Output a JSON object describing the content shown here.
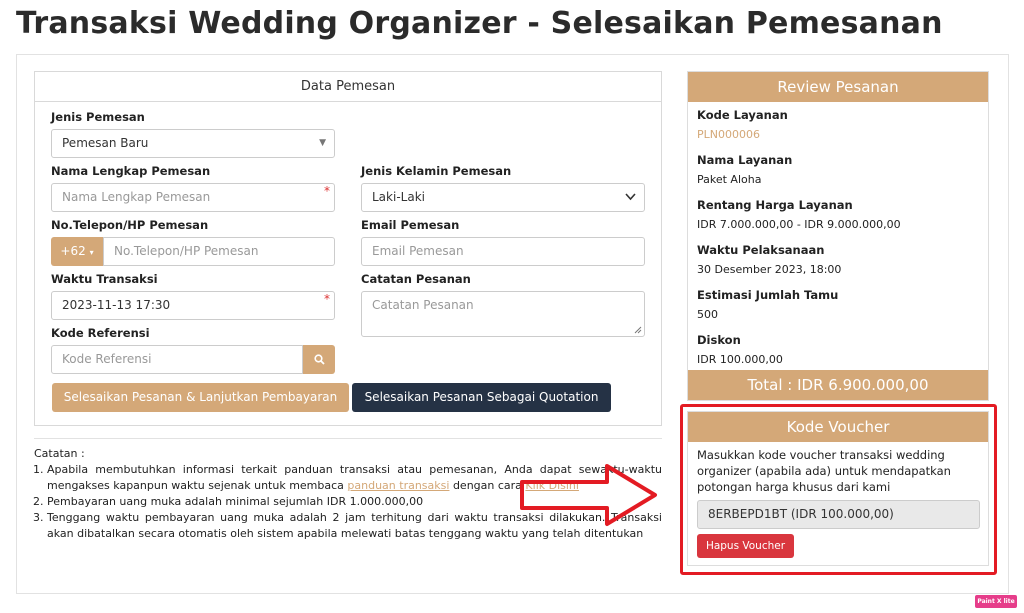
{
  "page": {
    "title": "Transaksi Wedding Organizer - Selesaikan Pemesanan"
  },
  "form": {
    "header": "Data Pemesan",
    "jenis_pemesan": {
      "label": "Jenis Pemesan",
      "value": "Pemesan Baru"
    },
    "nama": {
      "label": "Nama Lengkap Pemesan",
      "placeholder": "Nama Lengkap Pemesan"
    },
    "jenis_kelamin": {
      "label": "Jenis Kelamin Pemesan",
      "value": "Laki-Laki"
    },
    "telepon": {
      "label": "No.Telepon/HP Pemesan",
      "prefix": "+62",
      "placeholder": "No.Telepon/HP Pemesan"
    },
    "email": {
      "label": "Email Pemesan",
      "placeholder": "Email Pemesan"
    },
    "waktu": {
      "label": "Waktu Transaksi",
      "value": "2023-11-13 17:30"
    },
    "catatan": {
      "label": "Catatan Pesanan",
      "placeholder": "Catatan Pesanan"
    },
    "referensi": {
      "label": "Kode Referensi",
      "placeholder": "Kode Referensi"
    },
    "btn_bayar": "Selesaikan Pesanan & Lanjutkan Pembayaran",
    "btn_quotation": "Selesaikan Pesanan Sebagai Quotation"
  },
  "notes": {
    "title": "Catatan :",
    "item1_a": "Apabila membutuhkan informasi terkait panduan transaksi atau pemesanan, Anda dapat sewaktu-waktu mengakses kapanpun waktu sejenak untuk membaca ",
    "item1_link1": "panduan transaksi",
    "item1_b": " dengan cara ",
    "item1_link2": "Klik Disini",
    "item2": "Pembayaran uang muka adalah minimal sejumlah IDR 1.000.000,00",
    "item3": "Tenggang waktu pembayaran uang muka adalah 2 jam terhitung dari waktu transaksi dilakukan. Transaksi akan dibatalkan secara otomatis oleh sistem apabila melewati batas tenggang waktu yang telah ditentukan"
  },
  "review": {
    "header": "Review Pesanan",
    "kode_label": "Kode Layanan",
    "kode_value": "PLN000006",
    "nama_label": "Nama Layanan",
    "nama_value": "Paket Aloha",
    "harga_label": "Rentang Harga Layanan",
    "harga_value": "IDR 7.000.000,00 - IDR 9.000.000,00",
    "waktu_label": "Waktu Pelaksanaan",
    "waktu_value": "30 Desember 2023, 18:00",
    "tamu_label": "Estimasi Jumlah Tamu",
    "tamu_value": "500",
    "diskon_label": "Diskon",
    "diskon_value": "IDR 100.000,00",
    "total": "Total : IDR 6.900.000,00"
  },
  "voucher": {
    "header": "Kode Voucher",
    "text": "Masukkan kode voucher transaksi wedding organizer (apabila ada) untuk mendapatkan potongan harga khusus dari kami",
    "code": "8ERBEPD1BT (IDR 100.000,00)",
    "btn_hapus": "Hapus Voucher"
  },
  "badge": "Paint X lite",
  "colors": {
    "accent": "#d4a878",
    "dark": "#253245",
    "highlight": "#e31b23"
  }
}
